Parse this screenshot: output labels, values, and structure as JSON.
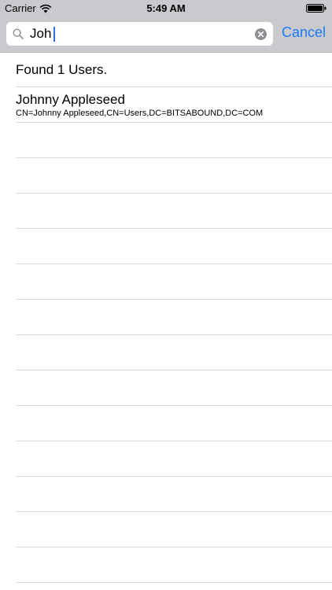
{
  "status_bar": {
    "carrier": "Carrier",
    "time": "5:49 AM"
  },
  "search": {
    "value": "Joh",
    "cancel_label": "Cancel"
  },
  "results": {
    "summary": "Found 1 Users.",
    "users": [
      {
        "name": "Johnny Appleseed",
        "dn": "CN=Johnny Appleseed,CN=Users,DC=BITSABOUND,DC=COM"
      }
    ]
  },
  "colors": {
    "accent": "#1a7cf5",
    "header_bg": "#c9c9ce",
    "separator": "#dcdcdc"
  },
  "icons": {
    "search": "search-icon",
    "clear": "clear-icon",
    "wifi": "wifi-icon",
    "battery": "battery-icon"
  }
}
